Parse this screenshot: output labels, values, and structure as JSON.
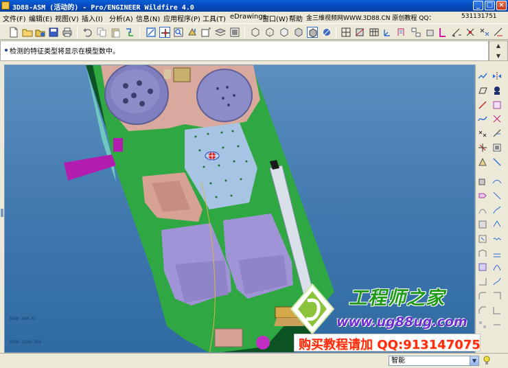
{
  "window": {
    "title": "3D88-ASM (活动的) - Pro/ENGINEER Wildfire 4.0",
    "minimize": "_",
    "maximize": "□",
    "close": "×"
  },
  "menu": {
    "items": [
      "文件(F)",
      "编辑(E)",
      "视图(V)",
      "插入(I)",
      "分析(A)",
      "信息(N)",
      "应用程序(P)",
      "工具(T)",
      "eDrawings",
      "窗口(W)",
      "帮助",
      "金三维视频网WWW.3D88.CN 原创教程 QQ：",
      "531131751"
    ]
  },
  "message": {
    "text": "检测的特征类型将显示在模型数中。"
  },
  "status": {
    "filter_value": "智能",
    "filter_arrow": "▼"
  },
  "watermark": {
    "brand": "工程师之家",
    "url": "www.ug88ug.com",
    "promo": "购买教程请加 QQ:913147075"
  },
  "viewport_labels": {
    "label_a": "3D88 ASM-01",
    "label_b": "3D88 2138-356"
  },
  "icons": {
    "toolbar": [
      "new-icon",
      "open-icon",
      "folder-icon",
      "save-icon",
      "print-icon",
      "undo-icon",
      "copy-icon",
      "paste-icon",
      "regenerate-icon",
      "repaint-icon",
      "spin-center-icon",
      "zoom-in-icon",
      "orient-icon",
      "zoom-fit-icon",
      "layers-icon",
      "saved-views-icon",
      "wireframe-icon",
      "hidden-line-icon",
      "no-hidden-icon",
      "shading-icon",
      "shading-active-icon",
      "datum-display-icon",
      "datum-plane-icon",
      "datum-axis-icon",
      "datum-point-icon",
      "coord-sys-icon",
      "annotation-icon",
      "model-tree-icon",
      "assemble-icon",
      "create-component-icon",
      "sketch-icon",
      "feature-icon",
      "pattern-icon"
    ],
    "right": [
      "sketch-icon",
      "plane-icon",
      "axis-icon",
      "curve-icon",
      "point-icon",
      "csys-icon",
      "analysis-icon",
      "extrude-icon",
      "revolve-icon",
      "sweep-icon",
      "blend-icon",
      "hole-icon",
      "shell-icon",
      "rib-icon",
      "draft-icon",
      "round-icon",
      "chamfer-icon",
      "pattern-icon",
      "mirror-icon",
      "merge-icon",
      "trim-icon",
      "offset-icon",
      "thicken-icon",
      "solidify-icon",
      "copy-icon"
    ],
    "status_bulb": "bulb-icon"
  }
}
